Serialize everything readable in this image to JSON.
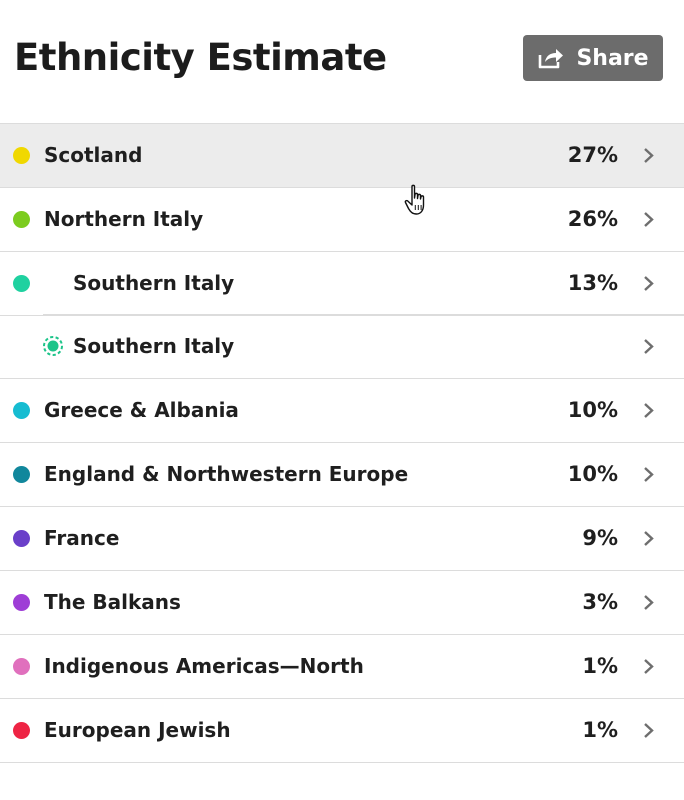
{
  "header": {
    "title": "Ethnicity Estimate",
    "share_label": "Share"
  },
  "colors": {
    "share_bg": "#6c6c6c",
    "row_hover_bg": "#ececec",
    "divider": "#dcdcdc"
  },
  "regions": [
    {
      "name": "Scotland",
      "percent": "27%",
      "color": "#f0d800",
      "hovered": true
    },
    {
      "name": "Northern Italy",
      "percent": "26%",
      "color": "#7ccc1f"
    },
    {
      "name": "Southern Italy",
      "percent": "13%",
      "color": "#1fd1a0"
    },
    {
      "name": "Southern Italy",
      "percent": "",
      "color": "#1ec48a",
      "sub_region": true
    },
    {
      "name": "Greece & Albania",
      "percent": "10%",
      "color": "#16bcd1"
    },
    {
      "name": "England & Northwestern Europe",
      "percent": "10%",
      "color": "#11879c"
    },
    {
      "name": "France",
      "percent": "9%",
      "color": "#6a3fc9"
    },
    {
      "name": "The Balkans",
      "percent": "3%",
      "color": "#9e3ed6"
    },
    {
      "name": "Indigenous Americas—North",
      "percent": "1%",
      "color": "#e070bd"
    },
    {
      "name": "European Jewish",
      "percent": "1%",
      "color": "#ee2444"
    }
  ]
}
